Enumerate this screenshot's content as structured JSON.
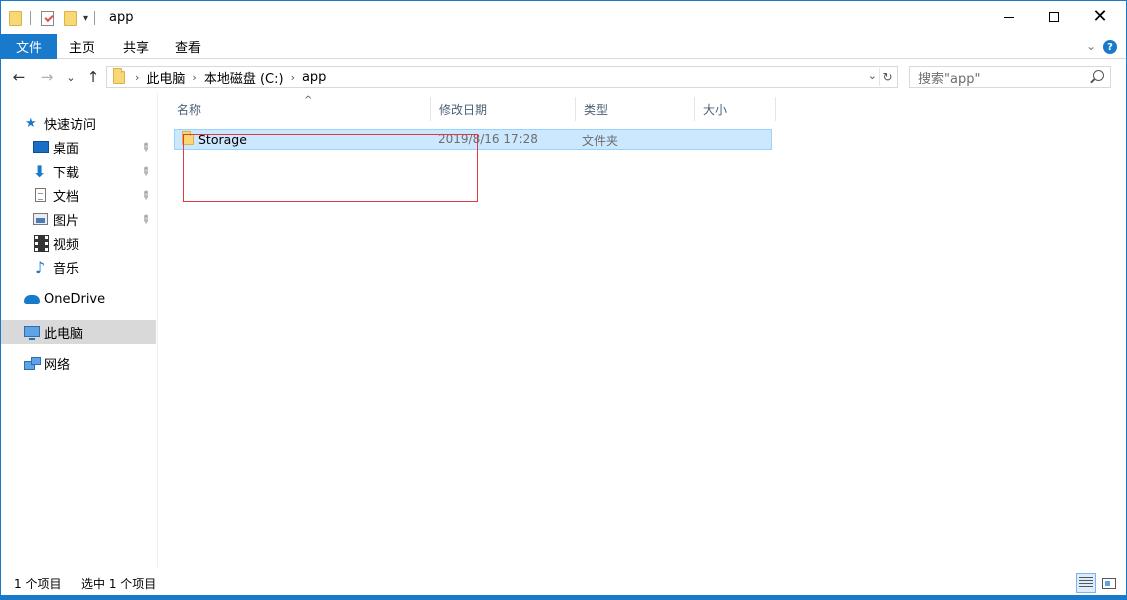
{
  "window": {
    "title": "app",
    "qa_dropdown": "▾",
    "minimize": "minimize",
    "maximize": "maximize",
    "close": "✕"
  },
  "ribbon": {
    "file": "文件",
    "tabs": [
      "主页",
      "共享",
      "查看"
    ],
    "collapse": "⌄",
    "help": "?"
  },
  "nav": {
    "back": "←",
    "forward": "→",
    "recent": "⌄",
    "up": "↑"
  },
  "address": {
    "parts": [
      "此电脑",
      "本地磁盘 (C:)",
      "app"
    ],
    "separator": "›",
    "dropdown": "⌄",
    "refresh": "↻"
  },
  "search": {
    "placeholder": "搜索\"app\""
  },
  "sidebar": {
    "quick_access": "快速访问",
    "items": [
      {
        "label": "桌面",
        "icon": "desktop-icon",
        "pinned": true
      },
      {
        "label": "下载",
        "icon": "download-icon",
        "pinned": true
      },
      {
        "label": "文档",
        "icon": "document-icon",
        "pinned": true
      },
      {
        "label": "图片",
        "icon": "picture-icon",
        "pinned": true
      },
      {
        "label": "视频",
        "icon": "video-icon",
        "pinned": false
      },
      {
        "label": "音乐",
        "icon": "music-icon",
        "pinned": false
      }
    ],
    "onedrive": "OneDrive",
    "this_pc": "此电脑",
    "network": "网络",
    "pin_glyph": "📌"
  },
  "list": {
    "columns": [
      "名称",
      "修改日期",
      "类型",
      "大小"
    ],
    "sort_indicator": "^",
    "rows": [
      {
        "name": "Storage",
        "modified": "2019/8/16 17:28",
        "type": "文件夹",
        "size": ""
      }
    ]
  },
  "status": {
    "item_count": "1 个项目",
    "selected": "选中 1 个项目"
  },
  "colors": {
    "accent": "#1979ca",
    "selection": "#cce8ff",
    "highlight_box": "#e0393e"
  }
}
